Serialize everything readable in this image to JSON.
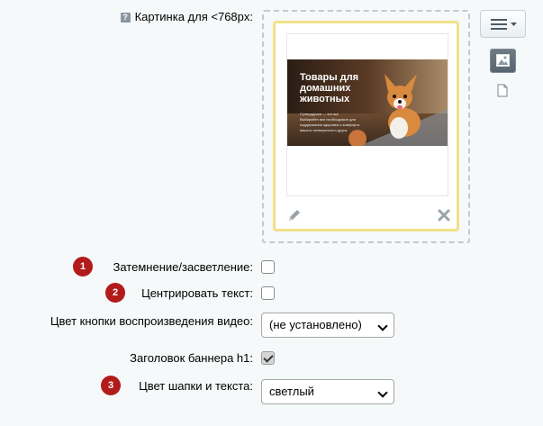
{
  "image_field": {
    "help_glyph": "?",
    "label": "Картинка для <768px:",
    "banner": {
      "heading_line1": "Товары для",
      "heading_line2": "домашних",
      "heading_line3": "животных",
      "body_line1": "Супердрузья — это вы!",
      "body_line2": "Выбирайте все необходимое для",
      "body_line3": "поддержания здоровья и комфорта",
      "body_line4": "вашего четвероногого друга."
    }
  },
  "toolbar": {
    "menu_icon": "hamburger-menu-icon",
    "image_icon": "image-icon",
    "file_icon": "file-icon"
  },
  "fields": [
    {
      "badge": "1",
      "label": "Затемнение/засветление:",
      "checked": false
    },
    {
      "badge": "2",
      "label": "Центрировать текст:",
      "checked": false
    },
    {
      "label": "Цвет кнопки воспроизведения видео:",
      "value": "(не установлено)"
    },
    {
      "label": "Заголовок баннера h1:",
      "checked": true
    },
    {
      "badge": "3",
      "label": "Цвет шапки и текста:",
      "value": "светлый"
    }
  ],
  "colors": {
    "badge": "#b31b1b",
    "card_border": "#f1e08a",
    "background": "#f5f9f9"
  }
}
